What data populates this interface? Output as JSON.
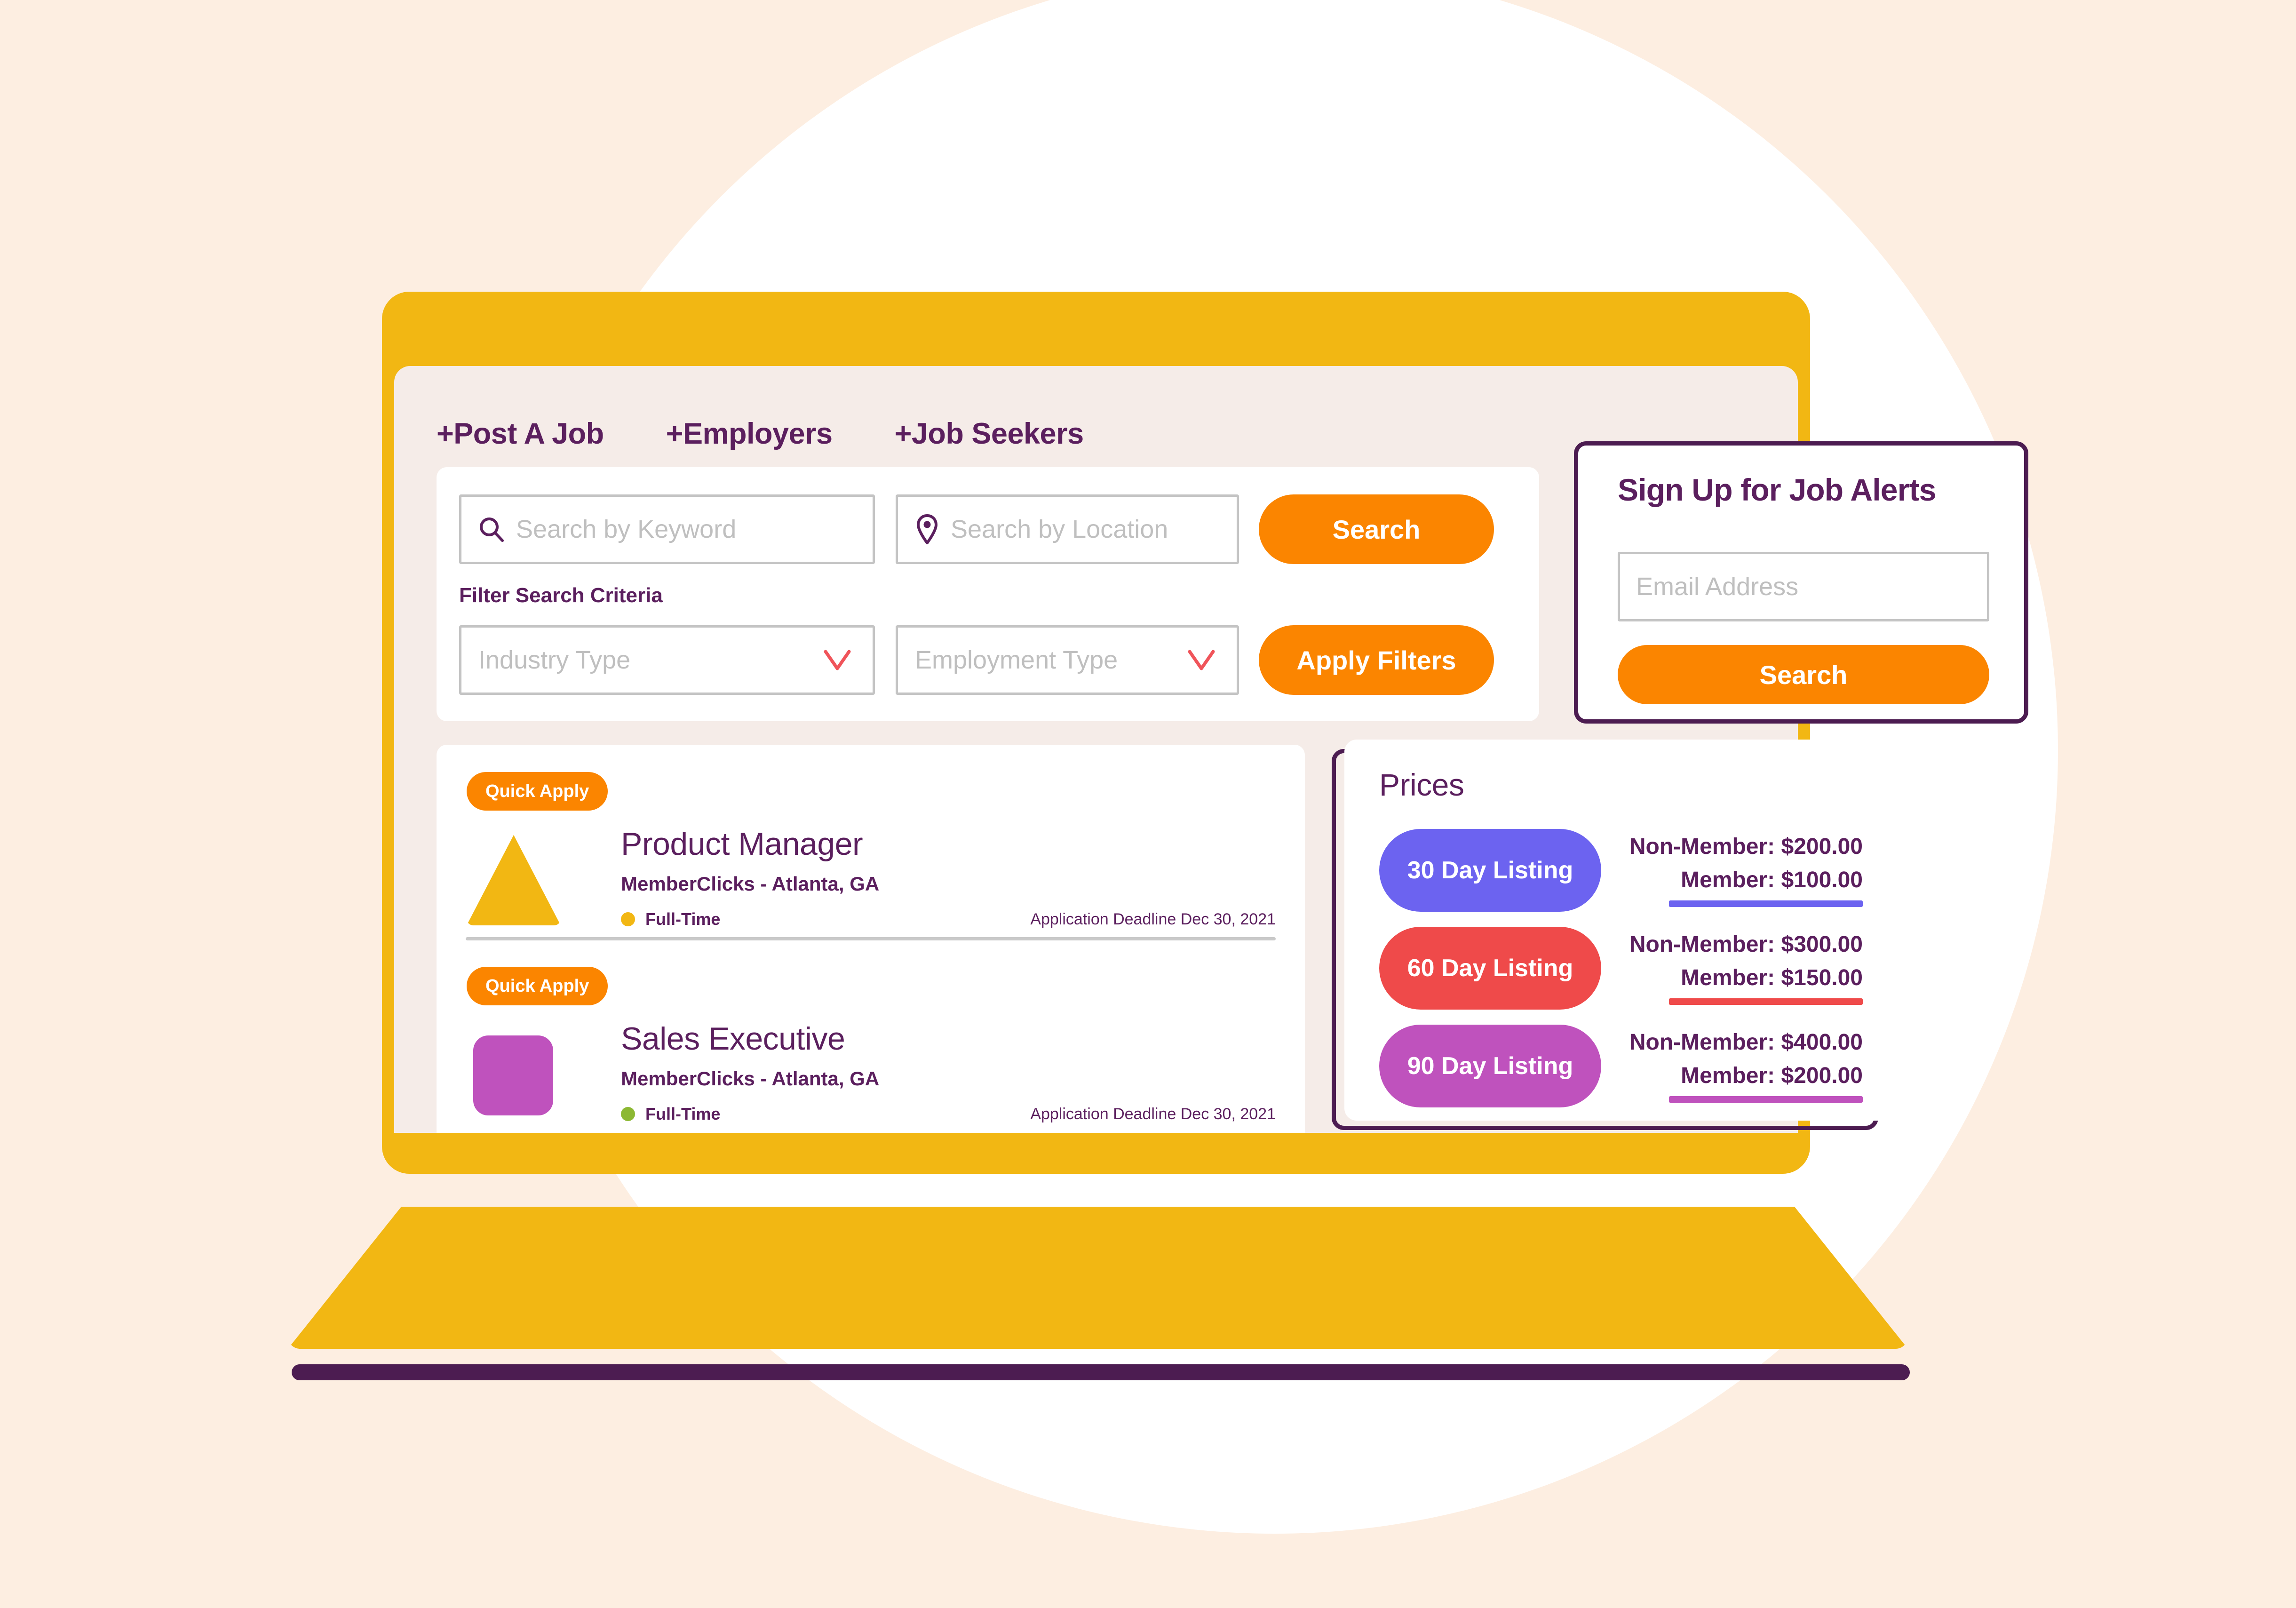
{
  "nav": {
    "items": [
      {
        "label": "+Post A Job"
      },
      {
        "label": "+Employers"
      },
      {
        "label": "+Job Seekers"
      }
    ]
  },
  "search": {
    "keyword_placeholder": "Search by Keyword",
    "location_placeholder": "Search by Location",
    "search_button": "Search",
    "filter_label": "Filter Search Criteria",
    "industry_placeholder": "Industry Type",
    "employment_placeholder": "Employment Type",
    "apply_filters_button": "Apply Filters"
  },
  "jobs": [
    {
      "quick_apply": "Quick Apply",
      "title": "Product Manager",
      "company": "MemberClicks - Atlanta, GA",
      "employment_type": "Full-Time",
      "deadline": "Application Deadline Dec 30, 2021",
      "icon": "triangle-icon",
      "icon_color": "#f2b713",
      "dot_color": "#f2b713"
    },
    {
      "quick_apply": "Quick Apply",
      "title": "Sales Executive",
      "company": "MemberClicks - Atlanta, GA",
      "employment_type": "Full-Time",
      "deadline": "Application Deadline Dec 30, 2021",
      "icon": "rounded-square-icon",
      "icon_color": "#bf52bd",
      "dot_color": "#8cb833"
    }
  ],
  "alerts": {
    "title": "Sign Up for Job Alerts",
    "email_placeholder": "Email Address",
    "search_button": "Search"
  },
  "prices": {
    "title": "Prices",
    "rows": [
      {
        "pill": "30 Day Listing",
        "pill_color": "#6c63f0",
        "non_member": "Non-Member: $200.00",
        "member": "Member: $100.00"
      },
      {
        "pill": "60 Day Listing",
        "pill_color": "#ef4a4a",
        "non_member": "Non-Member: $300.00",
        "member": "Member: $150.00"
      },
      {
        "pill": "90 Day Listing",
        "pill_color": "#bf52bd",
        "non_member": "Non-Member: $400.00",
        "member": "Member: $200.00"
      }
    ]
  },
  "theme": {
    "page_background": "#fdeee1",
    "circle": "#ffffff",
    "laptop_body": "#f2b713",
    "screen_background": "#f5ece8",
    "accent_orange": "#fb8500",
    "brand_purple": "#5b1f5e",
    "outline_purple": "#4c1c51",
    "placeholder_gray": "#bfbfbf",
    "chevron_red": "#f0545a"
  }
}
